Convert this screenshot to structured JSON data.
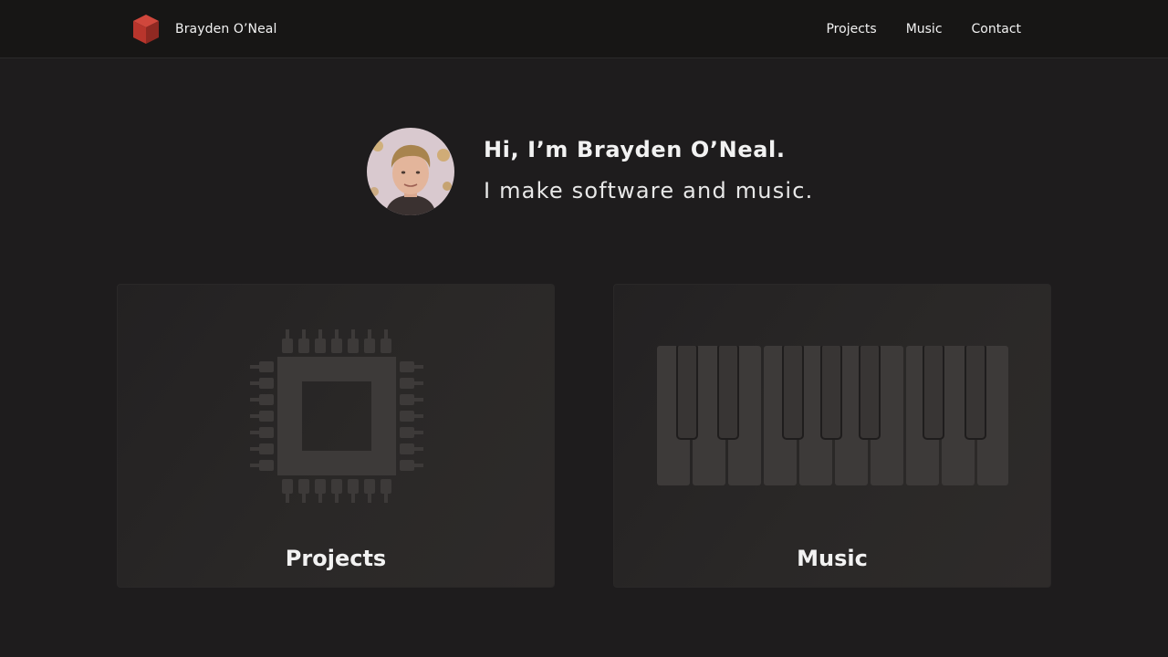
{
  "header": {
    "brand_name": "Brayden O’Neal",
    "nav": [
      {
        "label": "Projects"
      },
      {
        "label": "Music"
      },
      {
        "label": "Contact"
      }
    ]
  },
  "hero": {
    "title": "Hi, I’m Brayden O’Neal.",
    "subtitle": "I make software and music."
  },
  "cards": [
    {
      "label": "Projects",
      "icon": "microchip-icon"
    },
    {
      "label": "Music",
      "icon": "piano-keyboard-icon"
    }
  ],
  "colors": {
    "page_background": "#1e1c1d",
    "header_background": "#171615",
    "logo_red": "#b8352c",
    "icon_gray": "#3d3a39"
  }
}
